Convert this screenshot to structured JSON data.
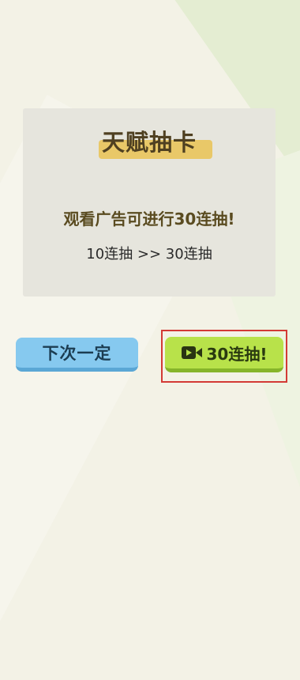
{
  "dialog": {
    "title": "天赋抽卡",
    "message": "观看广告可进行30连抽!",
    "sub_message": "10连抽 >> 30连抽"
  },
  "buttons": {
    "decline_label": "下次一定",
    "watch_ad_label": "30连抽!",
    "watch_ad_icon": "video-camera-icon"
  },
  "colors": {
    "title_highlight": "#e9c868",
    "decline_button": "#86c9ef",
    "watch_ad_button": "#b8e24a",
    "focus_frame": "#d33a35"
  }
}
